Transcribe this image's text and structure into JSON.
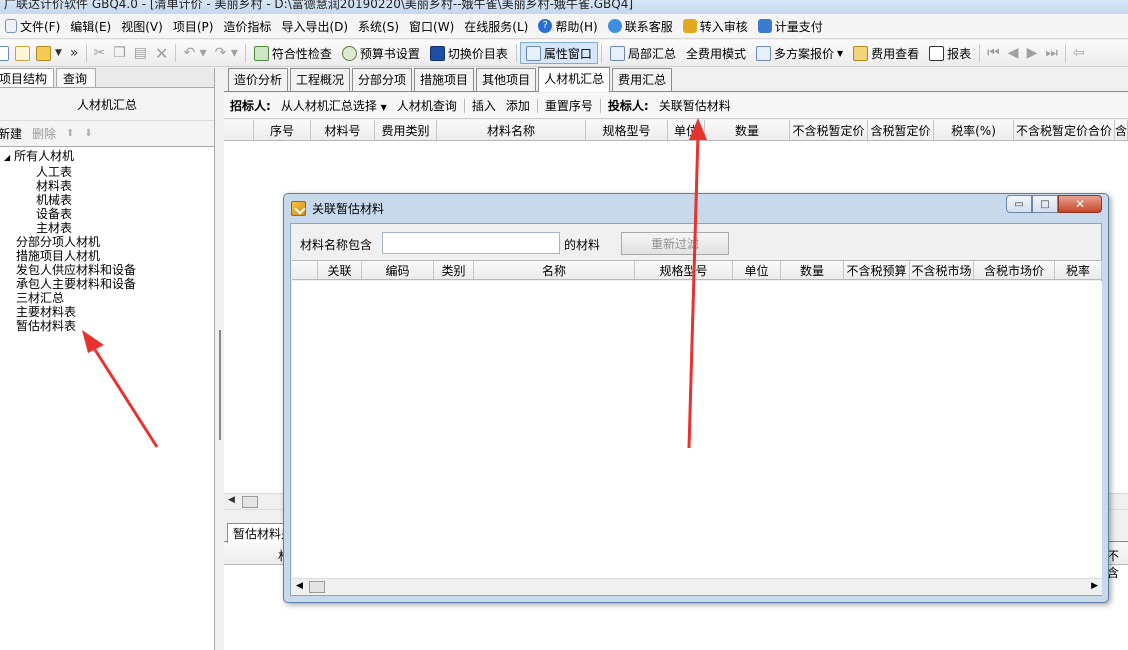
{
  "window": {
    "title": "广联达计价软件 GBQ4.0 - [清单计价 - 美丽乡村 - D:\\富德慧润20190220\\美丽乡村--娥牛雀\\美丽乡村-娥牛雀.GBQ4]"
  },
  "menu": [
    {
      "label": "文件(F)"
    },
    {
      "label": "编辑(E)"
    },
    {
      "label": "视图(V)"
    },
    {
      "label": "项目(P)"
    },
    {
      "label": "造价指标"
    },
    {
      "label": "导入导出(D)"
    },
    {
      "label": "系统(S)"
    },
    {
      "label": "窗口(W)"
    },
    {
      "label": "在线服务(L)"
    },
    {
      "label": "帮助(H)"
    },
    {
      "label": "联系客服"
    },
    {
      "label": "转入审核"
    },
    {
      "label": "计量支付"
    }
  ],
  "toolbar": {
    "compliance_check": "符合性检查",
    "budget_settings": "预算书设置",
    "switch_price_table": "切换价目表",
    "property_window": "属性窗口",
    "partial_summary": "局部汇总",
    "full_cost_mode": "全费用模式",
    "multi_plan_quote": "多方案报价",
    "cost_view": "费用查看",
    "report": "报表"
  },
  "left_panel": {
    "tabs": [
      "项目结构",
      "查询"
    ],
    "header": "人材机汇总",
    "actions": {
      "new": "新建",
      "delete": "删除",
      "up": "⬆",
      "down": "⬇"
    },
    "tree": {
      "root": "所有人材机",
      "children": [
        "人工表",
        "材料表",
        "机械表",
        "设备表",
        "主材表"
      ],
      "siblings": [
        "分部分项人材机",
        "措施项目人材机",
        "发包人供应材料和设备",
        "承包人主要材料和设备",
        "三材汇总",
        "主要材料表",
        "暂估材料表"
      ]
    }
  },
  "main_tabs": [
    "造价分析",
    "工程概况",
    "分部分项",
    "措施项目",
    "其他项目",
    "人材机汇总",
    "费用汇总"
  ],
  "sub_toolbar": {
    "tenderer_label": "招标人:",
    "select_from_summary": "从人材机汇总选择",
    "query": "人材机查询",
    "insert": "插入",
    "add": "添加",
    "reset_seq": "重置序号",
    "bidder_label": "投标人:",
    "link_estimate": "关联暂估材料"
  },
  "grid": {
    "columns": [
      "序号",
      "材料号",
      "费用类别",
      "材料名称",
      "规格型号",
      "单位",
      "数量",
      "不含税暂定价",
      "含税暂定价",
      "税率(%)",
      "不含税暂定价合价",
      "含"
    ]
  },
  "bottom": {
    "tab": "暂估材料关联",
    "header_cells": [
      "材",
      "不含"
    ]
  },
  "dialog": {
    "title": "关联暂估材料",
    "filter_label": "材料名称包含",
    "filter_value": "",
    "filter_suffix": "的材料",
    "refilter_button": "重新过滤",
    "columns": [
      "关联",
      "编码",
      "类别",
      "名称",
      "规格型号",
      "单位",
      "数量",
      "不含税预算",
      "不含税市场",
      "含税市场价",
      "税率"
    ],
    "minimize": "▭",
    "maximize": "□",
    "close": "✕"
  },
  "colors": {
    "annotation_red": "#e8322d",
    "accent_blue": "#7fa9d8"
  }
}
